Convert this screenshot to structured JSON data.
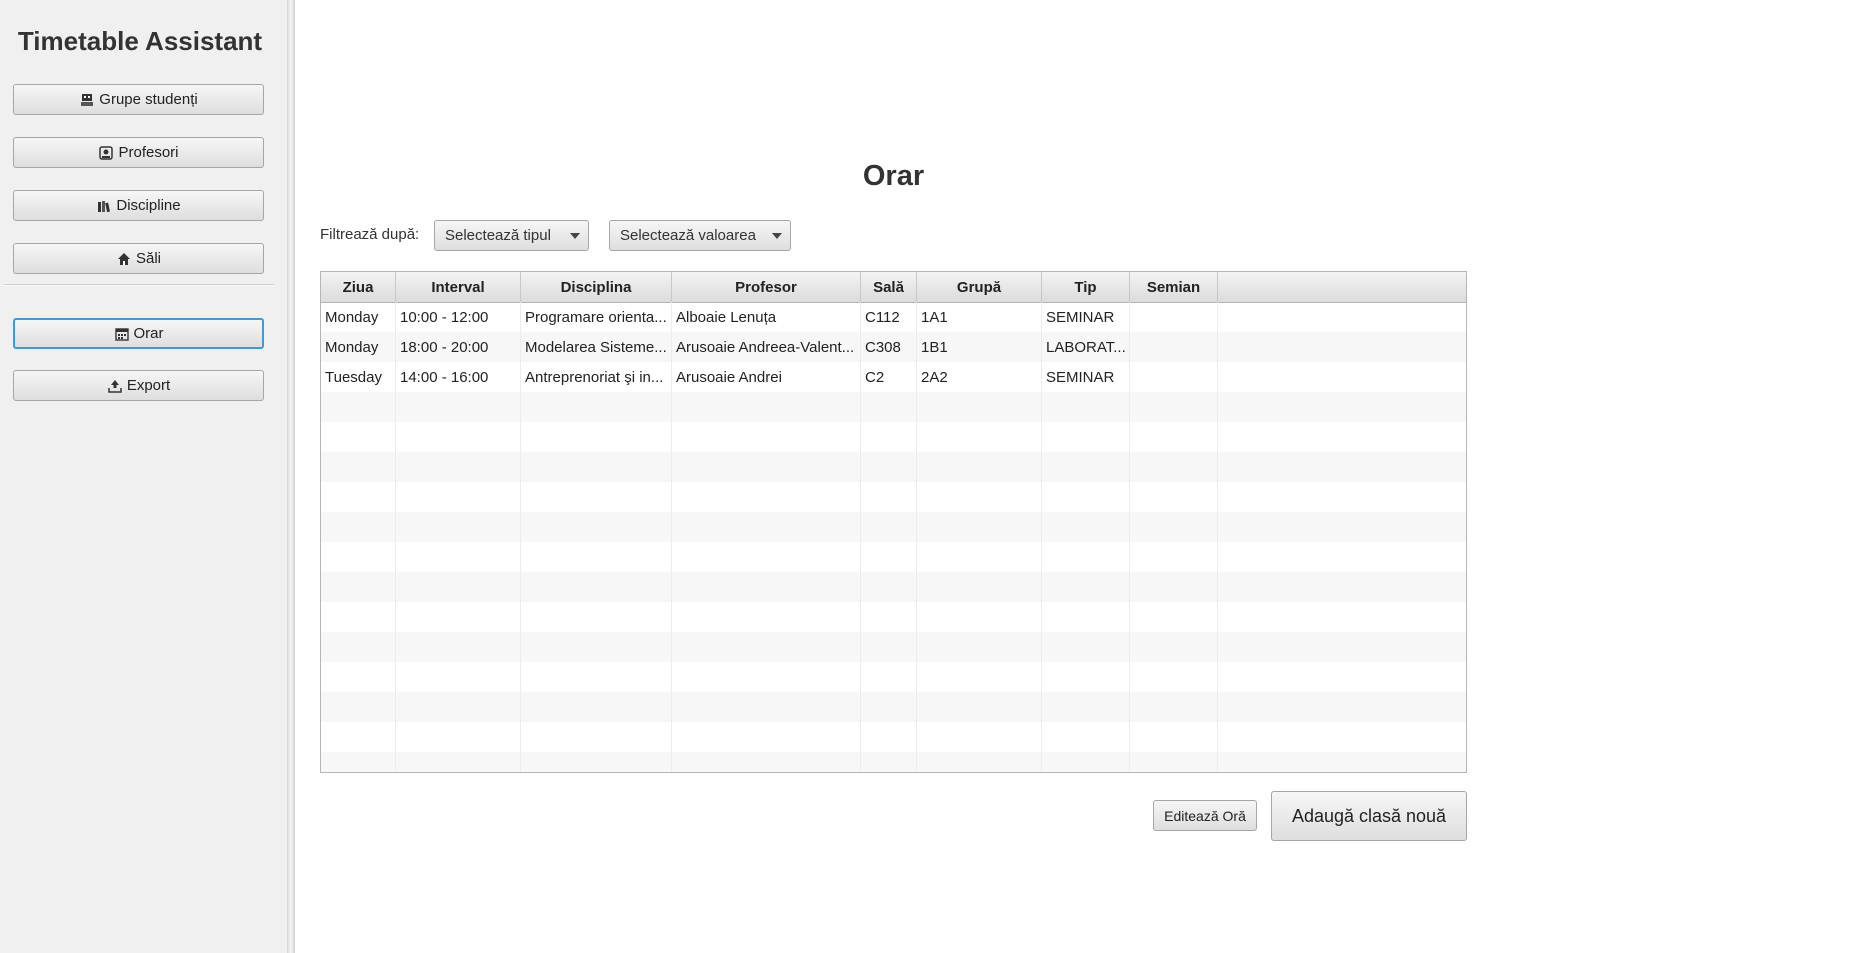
{
  "app": {
    "title": "Timetable Assistant"
  },
  "sidebar": {
    "items": [
      {
        "label": "Grupe studenți",
        "icon": "student-group-icon"
      },
      {
        "label": "Profesori",
        "icon": "teacher-icon"
      },
      {
        "label": "Discipline",
        "icon": "books-icon"
      },
      {
        "label": "Săli",
        "icon": "house-icon"
      },
      {
        "label": "Orar",
        "icon": "calendar-icon",
        "active": true
      },
      {
        "label": "Export",
        "icon": "upload-icon"
      }
    ]
  },
  "main": {
    "title": "Orar",
    "filter": {
      "label": "Filtrează după:",
      "type_placeholder": "Selectează tipul",
      "value_placeholder": "Selectează valoarea"
    },
    "table": {
      "columns": [
        "Ziua",
        "Interval",
        "Disciplina",
        "Profesor",
        "Sală",
        "Grupă",
        "Tip",
        "Semian"
      ],
      "rows": [
        [
          "Monday",
          "10:00 - 12:00",
          "Programare orienta...",
          "Alboaie Lenuța",
          "C112",
          "1A1",
          "SEMINAR",
          ""
        ],
        [
          "Monday",
          "18:00 - 20:00",
          "Modelarea Sisteme...",
          "Arusoaie Andreea-Valent...",
          "C308",
          "1B1",
          "LABORAT...",
          ""
        ],
        [
          "Tuesday",
          "14:00 - 16:00",
          "Antreprenoriat şi in...",
          "Arusoaie Andrei",
          "C2",
          "2A2",
          "SEMINAR",
          ""
        ]
      ]
    },
    "actions": {
      "edit": "Editează Oră",
      "add": "Adaugă clasă nouă"
    }
  },
  "colors": {
    "focus_border": "#3d9bdb",
    "sidebar_bg": "#f0f0f0"
  }
}
